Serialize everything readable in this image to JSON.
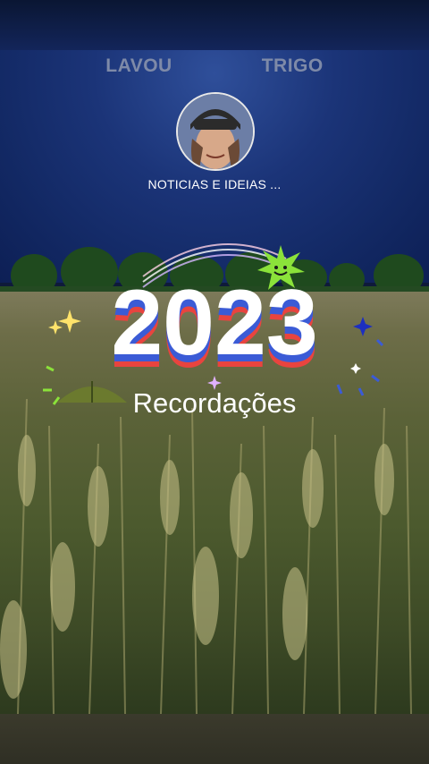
{
  "header": {
    "title_left": "LAVOU",
    "title_right": "TRIGO"
  },
  "channel": {
    "name": "NOTICIAS E IDEIAS ..."
  },
  "recap": {
    "year": "2023",
    "label": "Recordações"
  },
  "colors": {
    "year_fill": "#ffffff",
    "stripe_blue": "#3b5bd6",
    "stripe_red": "#e8443f",
    "accent_green": "#8be23a"
  }
}
